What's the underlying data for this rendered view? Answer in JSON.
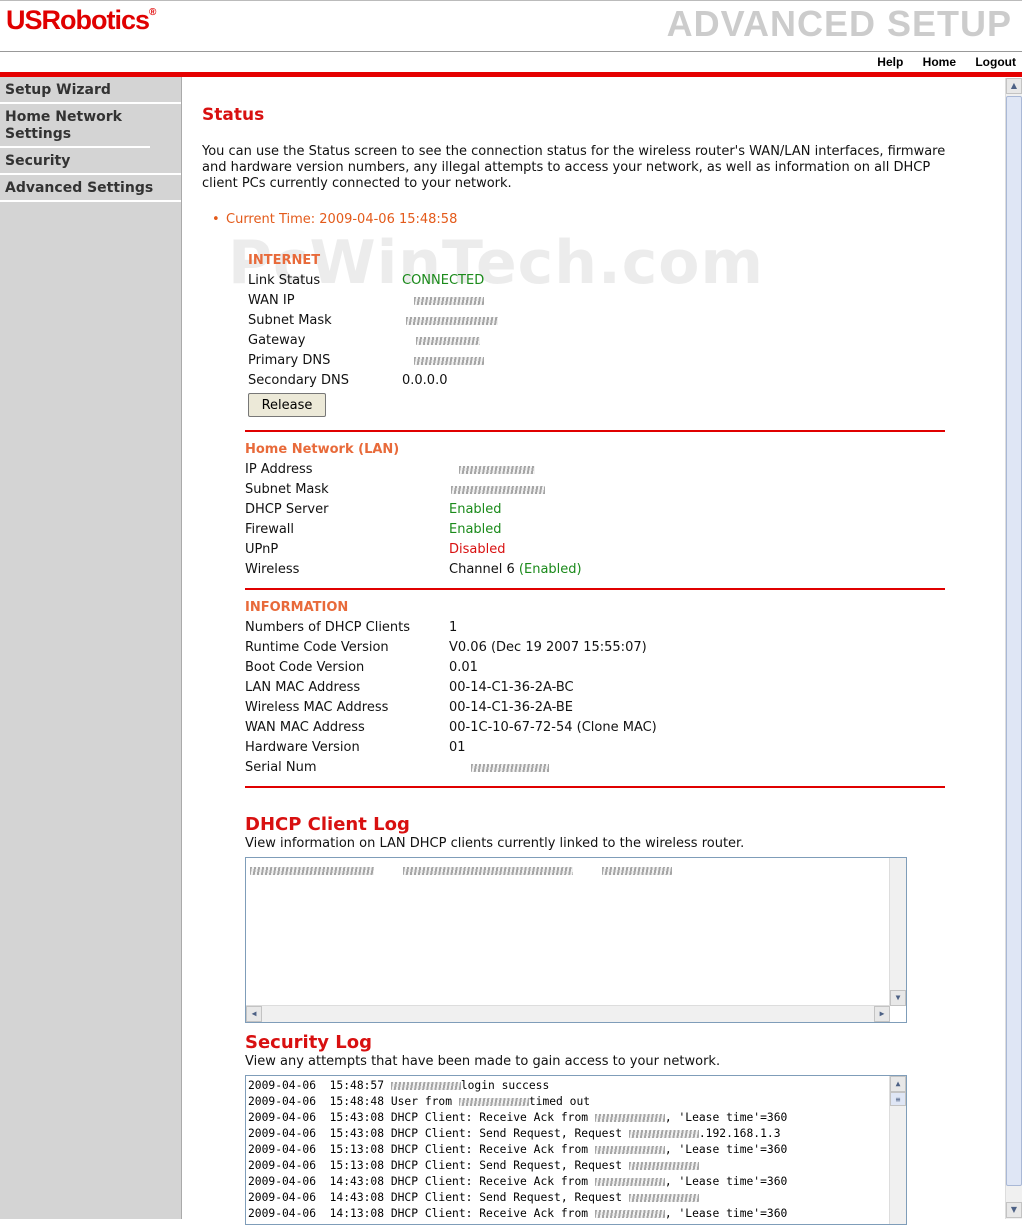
{
  "header": {
    "logo": "USRobotics",
    "page_title": "ADVANCED SETUP",
    "links": [
      "Help",
      "Home",
      "Logout"
    ]
  },
  "sidebar": {
    "items": [
      "Setup Wizard",
      "Home Network Settings",
      "Security",
      "Advanced Settings"
    ]
  },
  "main": {
    "title": "Status",
    "intro": "You can use the Status screen to see the connection status for the wireless router's WAN/LAN interfaces, firmware and hardware version numbers, any illegal attempts to access your network, as well as information on all DHCP client PCs currently connected to your network.",
    "current_time": "Current Time: 2009-04-06 15:48:58",
    "watermark": "PcWinTech.com"
  },
  "internet": {
    "heading": "INTERNET",
    "link_status_label": "Link Status",
    "link_status_value": "CONNECTED",
    "wan_ip_label": "WAN IP",
    "subnet_label": "Subnet Mask",
    "gateway_label": "Gateway",
    "primary_dns_label": "Primary DNS",
    "secondary_dns_label": "Secondary DNS",
    "secondary_dns_value": "0.0.0.0",
    "release_button": "Release"
  },
  "lan": {
    "heading": "Home Network (LAN)",
    "ip_label": "IP Address",
    "subnet_label": "Subnet Mask",
    "dhcp_label": "DHCP Server",
    "dhcp_value": "Enabled",
    "firewall_label": "Firewall",
    "firewall_value": "Enabled",
    "upnp_label": "UPnP",
    "upnp_value": "Disabled",
    "wireless_label": "Wireless",
    "wireless_channel": "Channel 6",
    "wireless_state": "(Enabled)"
  },
  "info": {
    "heading": "INFORMATION",
    "rows": [
      {
        "label": "Numbers of DHCP Clients",
        "value": "1"
      },
      {
        "label": "Runtime Code Version",
        "value": "V0.06 (Dec 19 2007 15:55:07)"
      },
      {
        "label": "Boot Code Version",
        "value": "0.01"
      },
      {
        "label": "LAN MAC Address",
        "value": "00-14-C1-36-2A-BC"
      },
      {
        "label": "Wireless MAC Address",
        "value": "00-14-C1-36-2A-BE"
      },
      {
        "label": "WAN MAC Address",
        "value": "00-1C-10-67-72-54 (Clone MAC)"
      },
      {
        "label": "Hardware Version",
        "value": "01"
      },
      {
        "label": "Serial Num",
        "value": ""
      }
    ]
  },
  "dhcp_log": {
    "title": "DHCP Client Log",
    "description": "View information on LAN DHCP clients currently linked to the wireless router."
  },
  "security_log": {
    "title": "Security Log",
    "description": "View any attempts that have been made to gain access to your network.",
    "lines": [
      {
        "date": "2009-04-06",
        "time": "15:48:57",
        "pre": "",
        "post": "login success"
      },
      {
        "date": "2009-04-06",
        "time": "15:48:48",
        "pre": "User from",
        "post": "timed out"
      },
      {
        "date": "2009-04-06",
        "time": "15:43:08",
        "pre": "DHCP Client: Receive Ack from",
        "post": ", 'Lease time'=360"
      },
      {
        "date": "2009-04-06",
        "time": "15:43:08",
        "pre": "DHCP Client: Send Request, Request",
        "post": ".192.168.1.3"
      },
      {
        "date": "2009-04-06",
        "time": "15:13:08",
        "pre": "DHCP Client: Receive Ack from",
        "post": ", 'Lease time'=360"
      },
      {
        "date": "2009-04-06",
        "time": "15:13:08",
        "pre": "DHCP Client: Send Request, Request",
        "post": ""
      },
      {
        "date": "2009-04-06",
        "time": "14:43:08",
        "pre": "DHCP Client: Receive Ack from",
        "post": ", 'Lease time'=360"
      },
      {
        "date": "2009-04-06",
        "time": "14:43:08",
        "pre": "DHCP Client: Send Request, Request",
        "post": ""
      },
      {
        "date": "2009-04-06",
        "time": "14:13:08",
        "pre": "DHCP Client: Receive Ack from",
        "post": ", 'Lease time'=360"
      }
    ]
  }
}
